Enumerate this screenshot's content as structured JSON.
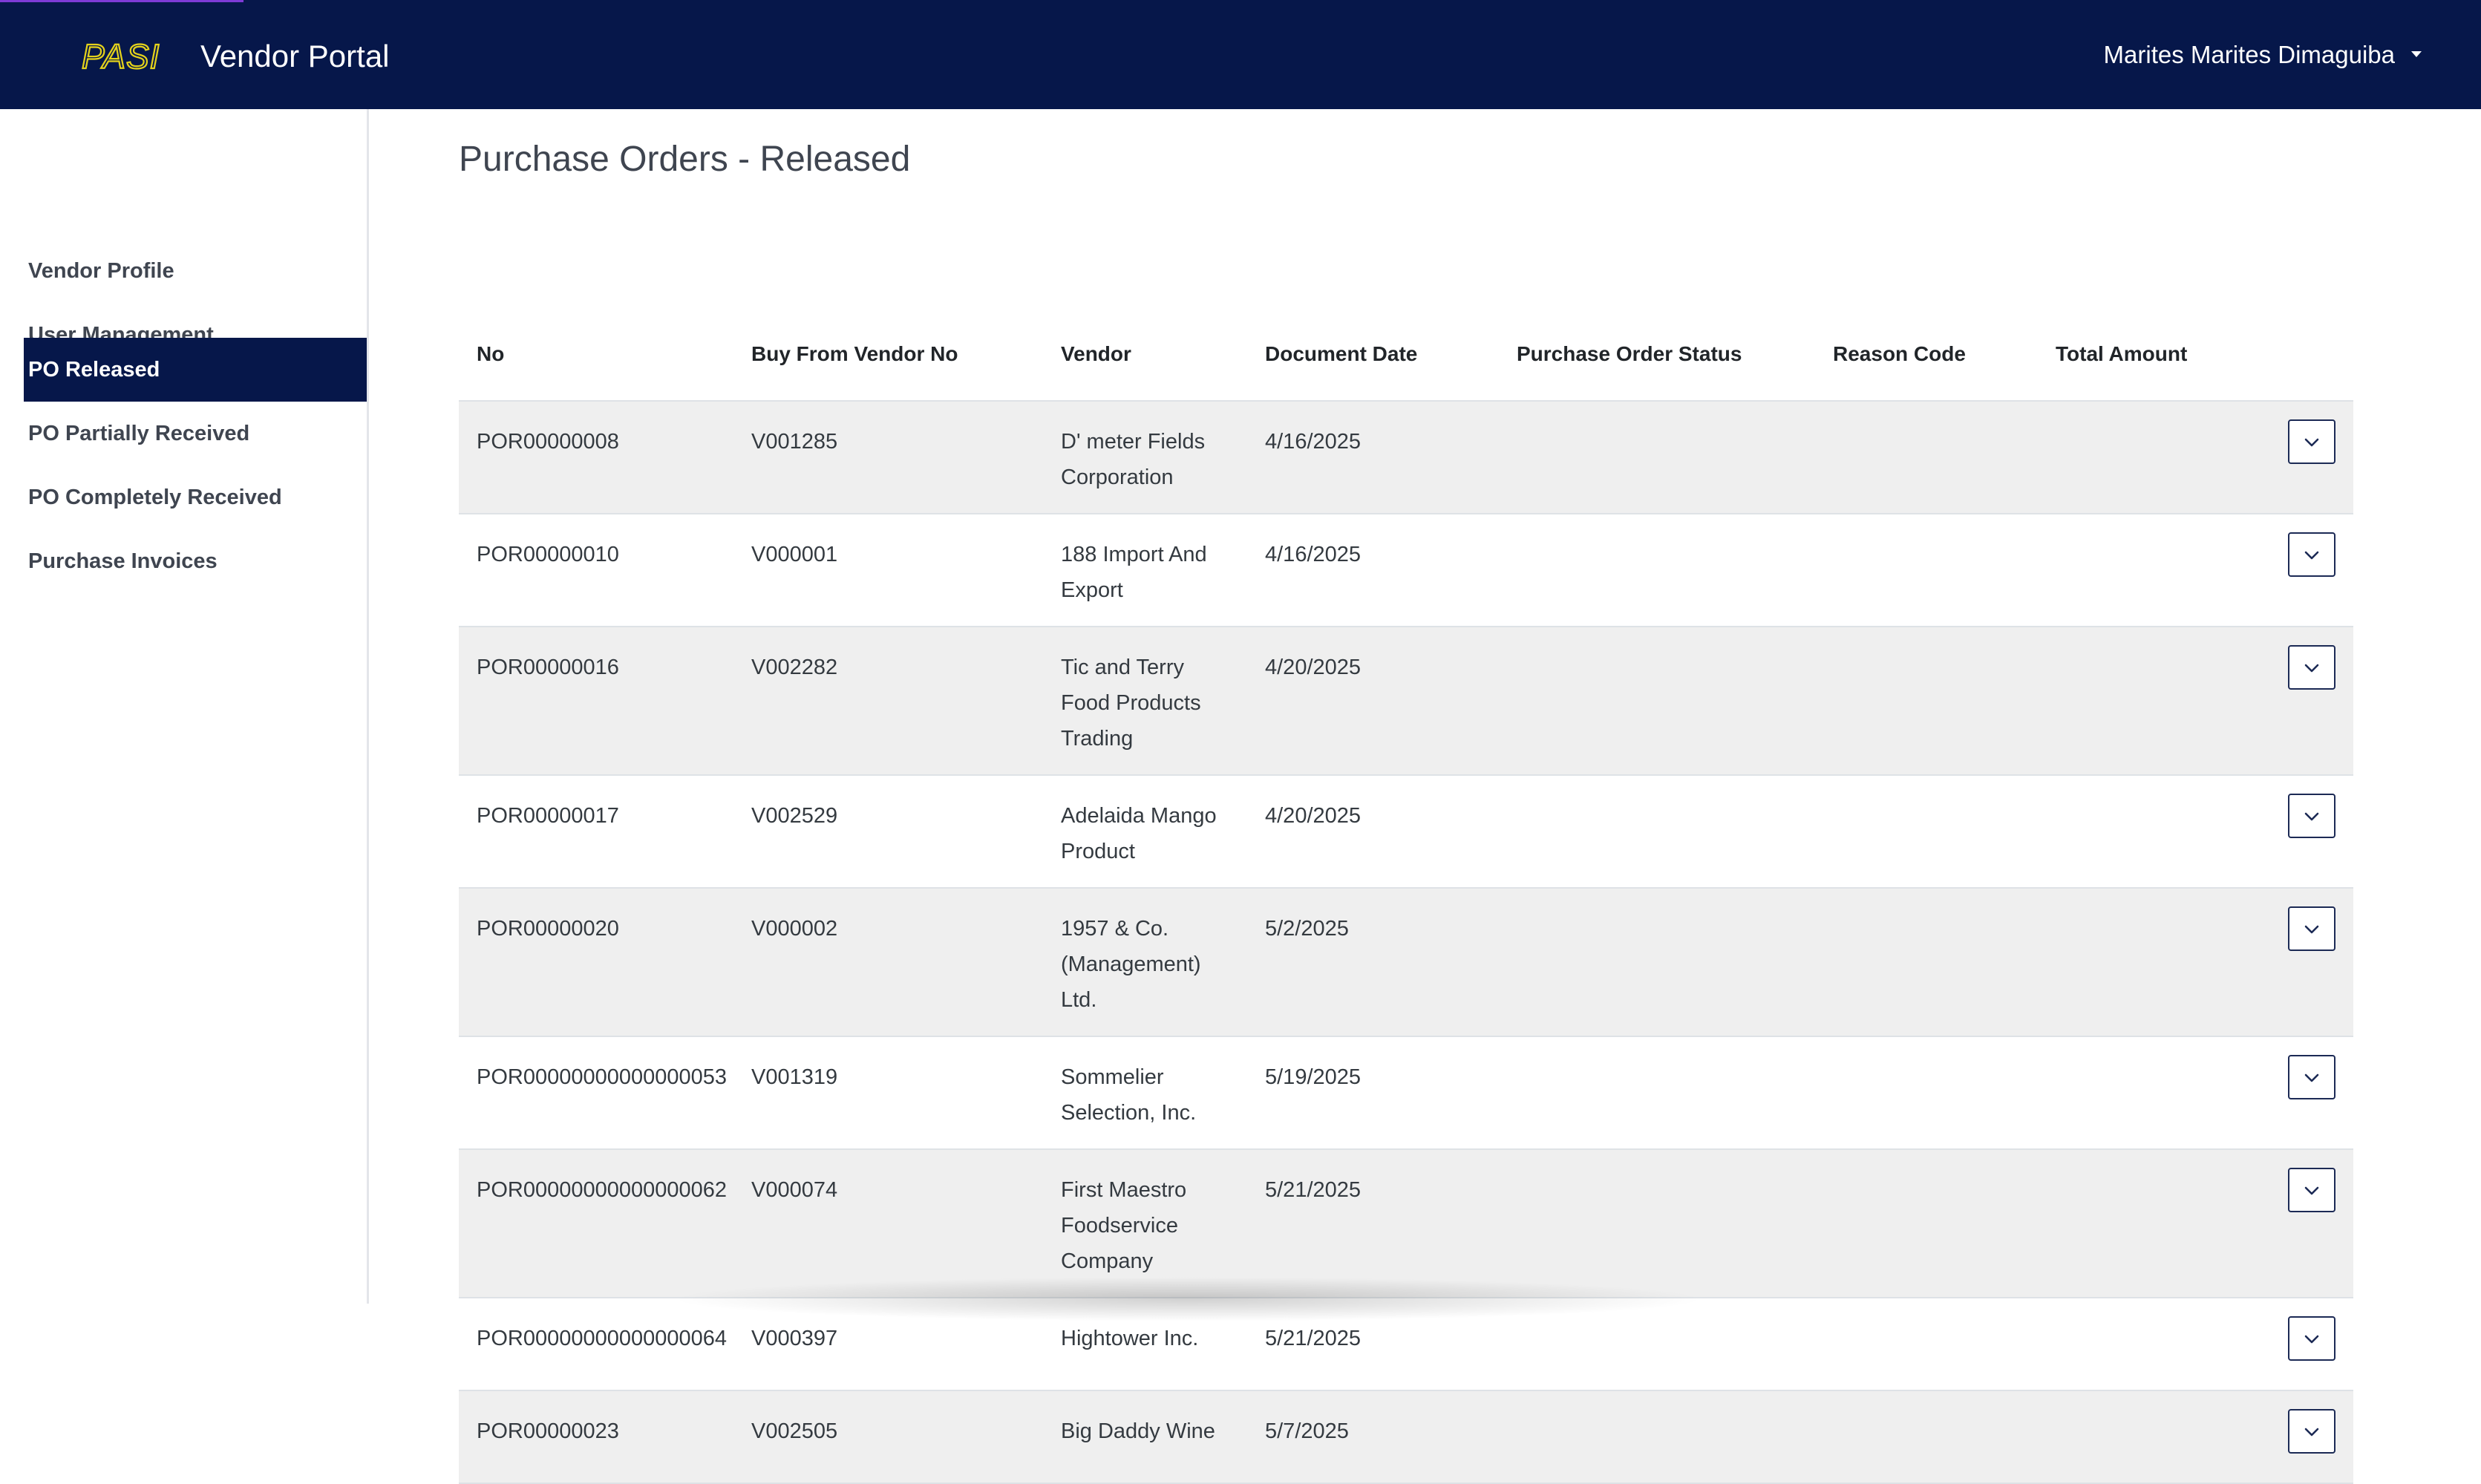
{
  "header": {
    "logo_text": "PASI",
    "brand": "Vendor Portal",
    "user": "Marites Marites Dimaguiba"
  },
  "sidebar": {
    "items": [
      {
        "label": "Vendor Profile",
        "active": false
      },
      {
        "label": "User Management",
        "active": false
      },
      {
        "label": "PO Released",
        "active": true
      },
      {
        "label": "PO Partially Received",
        "active": false
      },
      {
        "label": "PO Completely Received",
        "active": false
      },
      {
        "label": "Purchase Invoices",
        "active": false
      }
    ]
  },
  "main": {
    "title": "Purchase Orders - Released",
    "columns": [
      "No",
      "Buy From Vendor No",
      "Vendor",
      "Document Date",
      "Purchase Order Status",
      "Reason Code",
      "Total Amount"
    ],
    "rows": [
      {
        "no": "POR00000008",
        "vendor_no": "V001285",
        "vendor": "D' meter Fields Corporation",
        "date": "4/16/2025",
        "status": "",
        "reason": "",
        "total": ""
      },
      {
        "no": "POR00000010",
        "vendor_no": "V000001",
        "vendor": "188 Import And Export",
        "date": "4/16/2025",
        "status": "",
        "reason": "",
        "total": ""
      },
      {
        "no": "POR00000016",
        "vendor_no": "V002282",
        "vendor": "Tic and Terry Food Products Trading",
        "date": "4/20/2025",
        "status": "",
        "reason": "",
        "total": ""
      },
      {
        "no": "POR00000017",
        "vendor_no": "V002529",
        "vendor": "Adelaida Mango Product",
        "date": "4/20/2025",
        "status": "",
        "reason": "",
        "total": ""
      },
      {
        "no": "POR00000020",
        "vendor_no": "V000002",
        "vendor": "1957 & Co. (Management) Ltd.",
        "date": "5/2/2025",
        "status": "",
        "reason": "",
        "total": ""
      },
      {
        "no": "POR00000000000000053",
        "vendor_no": "V001319",
        "vendor": "Sommelier Selection, Inc.",
        "date": "5/19/2025",
        "status": "",
        "reason": "",
        "total": ""
      },
      {
        "no": "POR00000000000000062",
        "vendor_no": "V000074",
        "vendor": "First Maestro Foodservice Company",
        "date": "5/21/2025",
        "status": "",
        "reason": "",
        "total": ""
      },
      {
        "no": "POR00000000000000064",
        "vendor_no": "V000397",
        "vendor": "Hightower Inc.",
        "date": "5/21/2025",
        "status": "",
        "reason": "",
        "total": ""
      },
      {
        "no": "POR00000023",
        "vendor_no": "V002505",
        "vendor": "Big Daddy Wine",
        "date": "5/7/2025",
        "status": "",
        "reason": "",
        "total": ""
      }
    ]
  },
  "icons": {
    "row_action": "chevron-down-icon",
    "user_menu": "caret-down-icon"
  },
  "colors": {
    "header_bg": "#06174a",
    "active_nav_bg": "#06174a",
    "logo_yellow": "#e4d21b",
    "row_stripe": "#efefef"
  }
}
